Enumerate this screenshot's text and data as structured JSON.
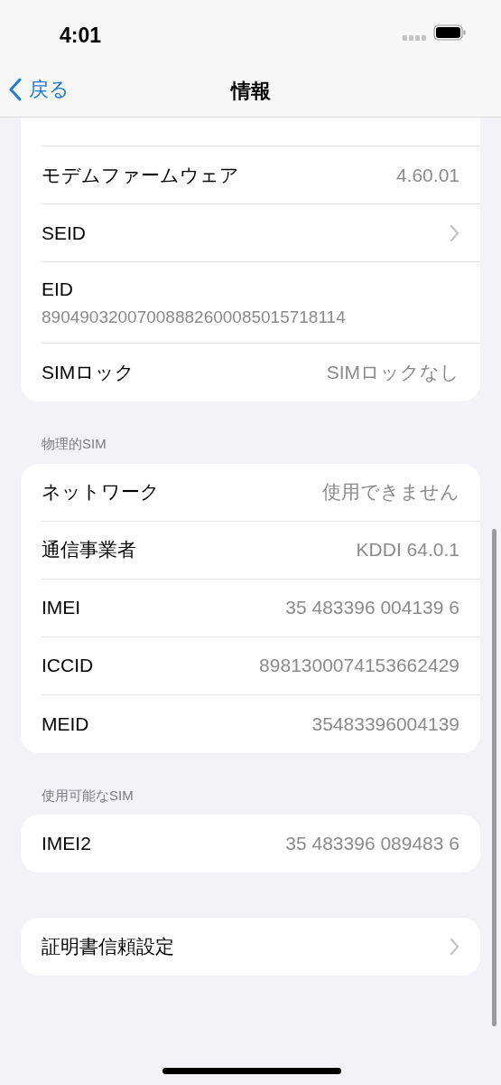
{
  "status_bar": {
    "time": "4:01"
  },
  "nav": {
    "back": "戻る",
    "title": "情報"
  },
  "sections": [
    {
      "rows": [
        {
          "kind": "value",
          "label": "モデムファームウェア",
          "value": "4.60.01"
        },
        {
          "kind": "link",
          "label": "SEID"
        },
        {
          "kind": "stacked",
          "label": "EID",
          "value": "89049032007008882600085015718114"
        },
        {
          "kind": "value",
          "label": "SIMロック",
          "value": "SIMロックなし"
        }
      ]
    },
    {
      "header": "物理的SIM",
      "rows": [
        {
          "kind": "value",
          "label": "ネットワーク",
          "value": "使用できません"
        },
        {
          "kind": "value",
          "label": "通信事業者",
          "value": "KDDI 64.0.1"
        },
        {
          "kind": "value",
          "label": "IMEI",
          "value": "35 483396 004139 6"
        },
        {
          "kind": "value",
          "label": "ICCID",
          "value": "8981300074153662429"
        },
        {
          "kind": "value",
          "label": "MEID",
          "value": "35483396004139"
        }
      ]
    },
    {
      "header": "使用可能なSIM",
      "rows": [
        {
          "kind": "value",
          "label": "IMEI2",
          "value": "35 483396 089483 6"
        }
      ]
    },
    {
      "rows": [
        {
          "kind": "link",
          "label": "証明書信頼設定"
        }
      ]
    }
  ]
}
